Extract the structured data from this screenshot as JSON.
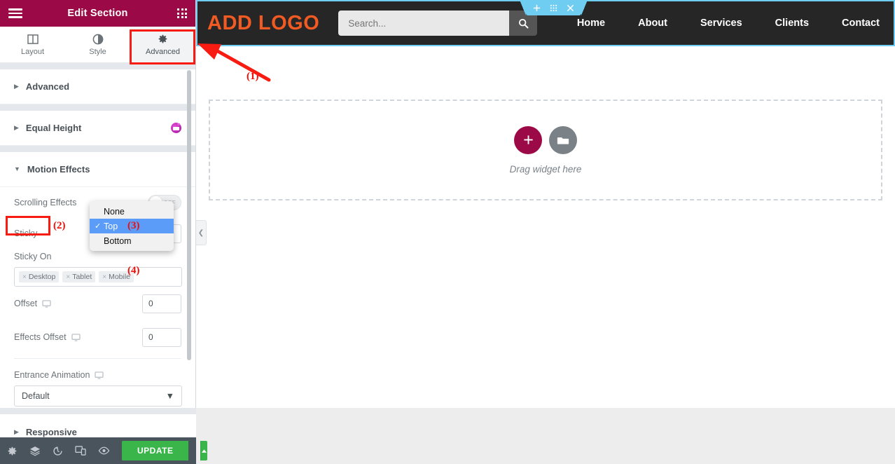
{
  "panel": {
    "header": {
      "title": "Edit Section",
      "menu_icon": "hamburger-icon",
      "apps_icon": "grid-apps-icon"
    },
    "tabs": [
      {
        "label": "Layout",
        "icon": "layout-columns-icon",
        "active": false
      },
      {
        "label": "Style",
        "icon": "contrast-circle-icon",
        "active": false
      },
      {
        "label": "Advanced",
        "icon": "gear-icon",
        "active": true
      }
    ],
    "sections": [
      {
        "label": "Advanced",
        "expanded": false,
        "pro": false
      },
      {
        "label": "Equal Height",
        "expanded": false,
        "pro": true
      },
      {
        "label": "Motion Effects",
        "expanded": true,
        "pro": false
      },
      {
        "label": "Responsive",
        "expanded": false,
        "pro": false
      }
    ],
    "controls": {
      "scrolling_effects": {
        "label": "Scrolling Effects",
        "state": "OFF"
      },
      "sticky": {
        "label": "Sticky",
        "value": "Top"
      },
      "sticky_on": {
        "label": "Sticky On",
        "tags": [
          "Desktop",
          "Tablet",
          "Mobile"
        ],
        "remove_icon": "close-x-icon"
      },
      "offset": {
        "label": "Offset",
        "value": "0",
        "device_icon": "desktop-icon"
      },
      "effects_offset": {
        "label": "Effects Offset",
        "value": "0",
        "device_icon": "desktop-icon"
      },
      "entrance_animation": {
        "label": "Entrance Animation",
        "value": "Default",
        "device_icon": "desktop-icon"
      }
    },
    "dropdown": {
      "options": [
        "None",
        "Top",
        "Bottom"
      ],
      "selected": "Top",
      "highlight_color": "#5a9cf8"
    },
    "footer": {
      "icons": [
        "settings-gear-icon",
        "navigator-layers-icon",
        "history-revisions-icon",
        "responsive-mode-icon",
        "preview-eye-icon"
      ],
      "update_label": "UPDATE",
      "update_color": "#39b54a",
      "caret_icon": "chevron-up-icon"
    },
    "collapse_icon": "chevron-left-icon"
  },
  "canvas": {
    "section_handle": {
      "add_icon": "plus-icon",
      "drag_icon": "grid-dots-icon",
      "close_icon": "close-x-icon",
      "color": "#6fcdf2"
    },
    "site_header": {
      "logo": "ADD LOGO",
      "logo_color": "#f15a22",
      "background": "#262626",
      "search": {
        "placeholder": "Search...",
        "value": "",
        "button_icon": "search-icon"
      },
      "nav": [
        "Home",
        "About",
        "Services",
        "Clients",
        "Contact"
      ]
    },
    "dropzone": {
      "text": "Drag widget here",
      "add_icon": "plus-icon",
      "template_icon": "folder-template-icon",
      "add_color": "#9b0a46"
    }
  },
  "annotations": [
    {
      "id": "1",
      "label": "(1)",
      "target": "advanced-tab"
    },
    {
      "id": "2",
      "label": "(2)",
      "target": "sticky-label"
    },
    {
      "id": "3",
      "label": "(3)",
      "target": "dropdown-top-option"
    },
    {
      "id": "4",
      "label": "(4)",
      "target": "sticky-on-tags"
    }
  ]
}
